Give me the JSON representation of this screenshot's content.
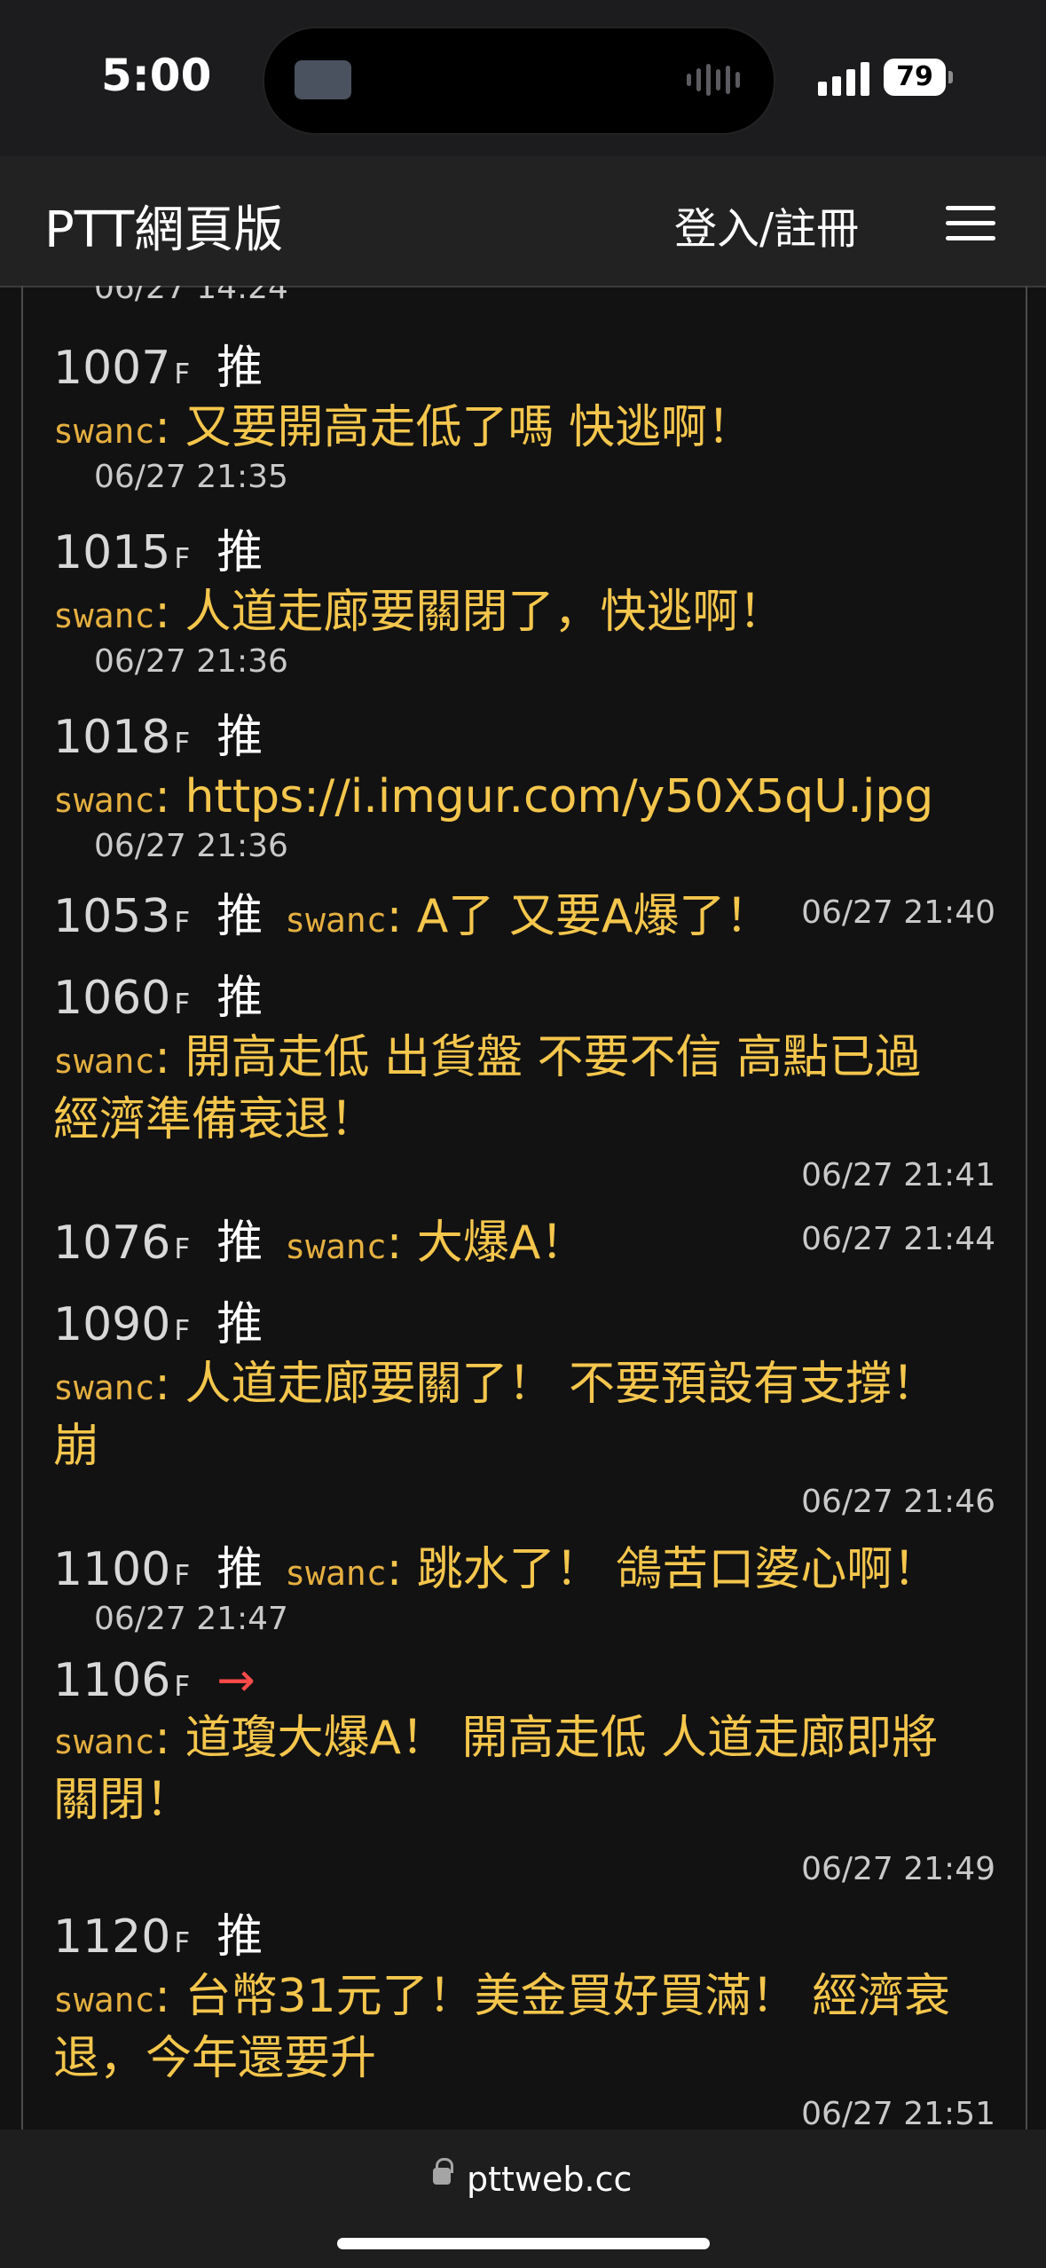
{
  "status": {
    "time": "5:00",
    "battery": "79"
  },
  "header": {
    "title": "PTT網頁版",
    "login": "登入/註冊"
  },
  "cutoff_timestamp": "06/27 14:24",
  "pushes": [
    {
      "floor": "1007",
      "suffix": "F",
      "tag": "推",
      "user": "swanc",
      "text": ": 又要開高走低了嗎 快逃啊！",
      "time": "06/27 21:35"
    },
    {
      "floor": "1015",
      "suffix": "F",
      "tag": "推",
      "user": "swanc",
      "text": ": 人道走廊要關閉了，快逃啊！",
      "time": "06/27 21:36"
    },
    {
      "floor": "1018",
      "suffix": "F",
      "tag": "推",
      "user": "swanc",
      "text": ": https://i.imgur.com/y50X5qU.jpg",
      "time": "06/27 21:36"
    },
    {
      "floor": "1053",
      "suffix": "F",
      "tag": "推",
      "user": "swanc",
      "text": ": A了 又要A爆了！",
      "time": "06/27 21:40"
    },
    {
      "floor": "1060",
      "suffix": "F",
      "tag": "推",
      "user": "swanc",
      "text": ": 開高走低 出貨盤 不要不信 高點已過",
      "text2": "經濟準備衰退！",
      "time": "06/27 21:41"
    },
    {
      "floor": "1076",
      "suffix": "F",
      "tag": "推",
      "user": "swanc",
      "text": ": 大爆A！",
      "time": "06/27 21:44"
    },
    {
      "floor": "1090",
      "suffix": "F",
      "tag": "推",
      "user": "swanc",
      "text": ": 人道走廊要關了！ 不要預設有支撐！",
      "text2": "崩",
      "time": "06/27 21:46"
    },
    {
      "floor": "1100",
      "suffix": "F",
      "tag": "推",
      "user": "swanc",
      "text": ": 跳水了！ 鴿苦口婆心啊！",
      "time": "06/27 21:47"
    },
    {
      "floor": "1106",
      "suffix": "F",
      "tag": "→",
      "user": "swanc",
      "text": ": 道瓊大爆A！ 開高走低 人道走廊即將",
      "text2": "關閉！",
      "time": "06/27 21:49"
    },
    {
      "floor": "1120",
      "suffix": "F",
      "tag": "推",
      "user": "swanc",
      "text": ": 台幣31元了！美金買好買滿！ 經濟衰",
      "text2": "退，今年還要升",
      "time": "06/27 21:51"
    }
  ],
  "bottom": {
    "url": "pttweb.cc"
  },
  "icons": {
    "menu": "hamburger-menu-icon",
    "lock": "lock-icon"
  }
}
